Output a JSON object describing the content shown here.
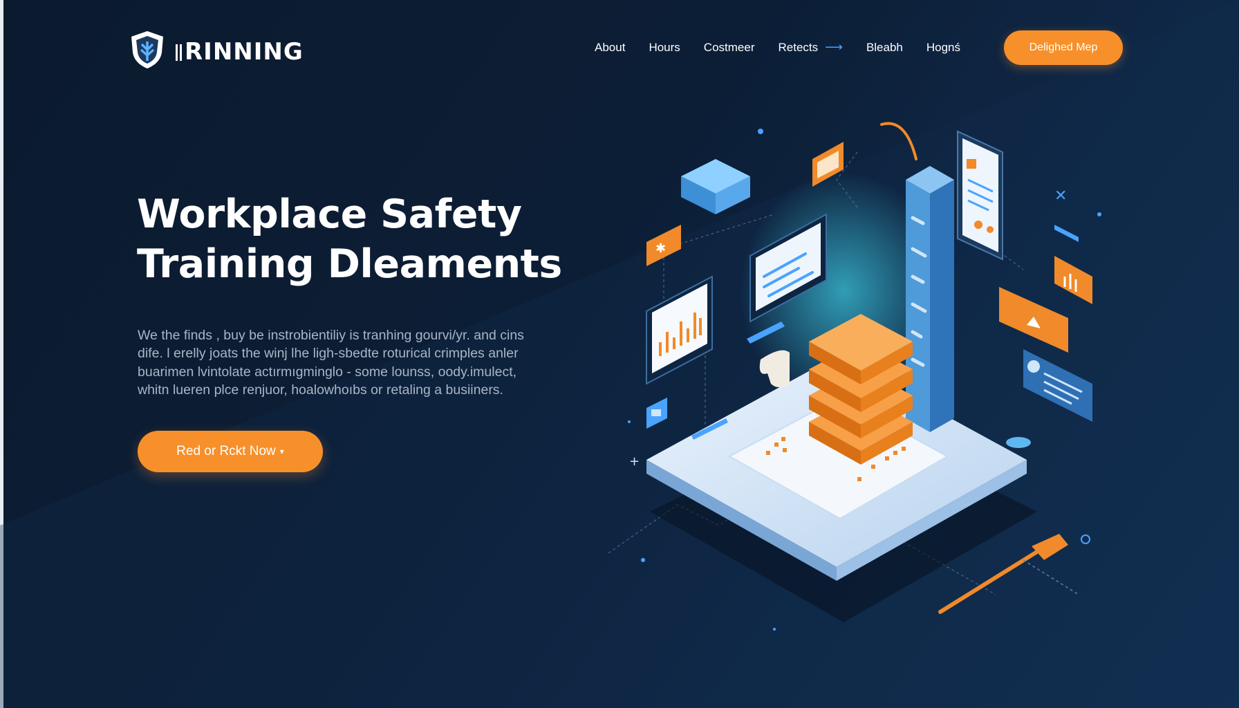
{
  "brand": {
    "name": "RINNING",
    "icon": "shield-icon"
  },
  "nav": {
    "items": [
      {
        "label": "About"
      },
      {
        "label": "Hours"
      },
      {
        "label": "Costmeer"
      },
      {
        "label": "Retects",
        "icon": "arrow-right-icon"
      },
      {
        "label": "Bleabh"
      },
      {
        "label": "Hognś"
      }
    ],
    "cta": "Delighed Mep"
  },
  "hero": {
    "title_line1": "Workplace Safety",
    "title_line2": "Training Dleaments",
    "description": "We the finds , buy be instrobientiliy is tranhing gourvi/yr. and cins dife. l erelly joats the winj lhe ligh-sbedte roturical crimples anler buarimen lvintolate actırmıgminglo - some lounss, oody.imulect, whitn lueren plce renjuor, hoalowhoıbs or retaling a busiiners.",
    "cta": "Red or Rckt Now",
    "cta_icon": "caret-down-icon"
  },
  "colors": {
    "accent": "#f7902a",
    "background": "#0c1e36",
    "highlight": "#4aa3ff",
    "tower": "#4f9ad8"
  },
  "illustration": {
    "name": "isometric-safety-training-platform"
  }
}
